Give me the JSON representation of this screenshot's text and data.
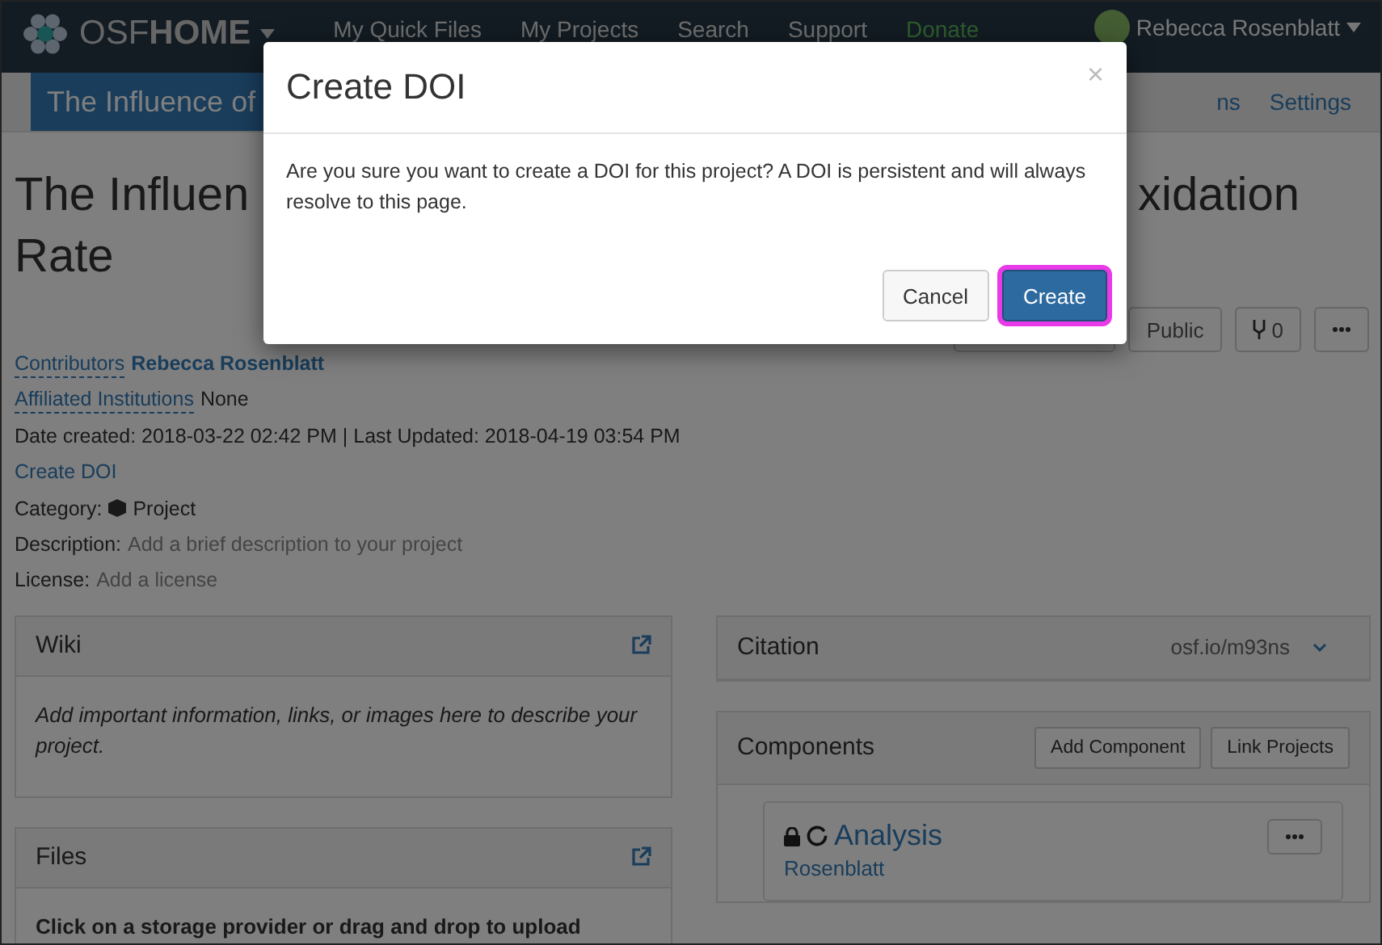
{
  "navbar": {
    "brand_light": "OSF",
    "brand_bold": "HOME",
    "links": [
      {
        "label": "My Quick Files",
        "kind": "link"
      },
      {
        "label": "My Projects",
        "kind": "link"
      },
      {
        "label": "Search",
        "kind": "link"
      },
      {
        "label": "Support",
        "kind": "link"
      },
      {
        "label": "Donate",
        "kind": "donate"
      }
    ],
    "user": "Rebecca Rosenblatt"
  },
  "project_bar": {
    "title": "The Influence of",
    "links": [
      "ns",
      "Settings"
    ]
  },
  "title": {
    "left": "The Influen",
    "right": "xidation",
    "line2": "Rate"
  },
  "actions": {
    "public": "Public",
    "forks": "0"
  },
  "meta": {
    "contributors_label": "Contributors",
    "contributors": "Rebecca Rosenblatt",
    "institutions_label": "Affiliated Institutions",
    "institutions": "None",
    "dates": "Date created: 2018-03-22 02:42 PM | Last Updated: 2018-04-19 03:54 PM",
    "create_doi": "Create DOI",
    "category_label": "Category:",
    "category": "Project",
    "description_label": "Description:",
    "description": "Add a brief description to your project",
    "license_label": "License:",
    "license": "Add a license"
  },
  "wiki": {
    "title": "Wiki",
    "text": "Add important information, links, or images here to describe your project."
  },
  "files": {
    "title": "Files",
    "text": "Click on a storage provider or drag and drop to upload"
  },
  "citation": {
    "title": "Citation",
    "link": "osf.io/m93ns"
  },
  "components": {
    "title": "Components",
    "buttons": [
      "Add Component",
      "Link Projects"
    ],
    "items": [
      {
        "name": "Analysis",
        "contributor": "Rosenblatt",
        "locked": true
      }
    ]
  },
  "modal": {
    "title": "Create DOI",
    "close": "×",
    "body": "Are you sure you want to create a DOI for this project? A DOI is persistent and will always resolve to this page.",
    "buttons": [
      {
        "label": "Cancel",
        "kind": "default",
        "focused": false
      },
      {
        "label": "Create",
        "kind": "primary",
        "focused": true
      }
    ]
  }
}
